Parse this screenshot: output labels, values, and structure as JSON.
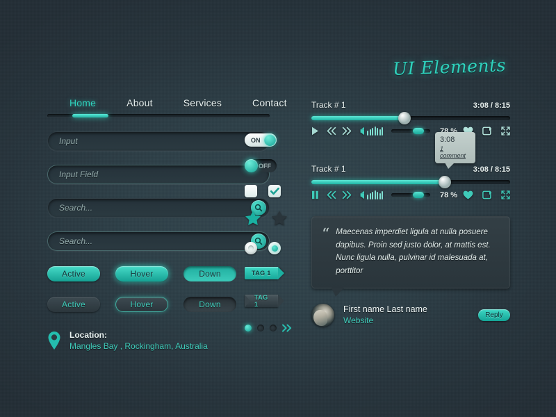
{
  "page": {
    "title": "UI Elements"
  },
  "nav": {
    "items": [
      {
        "label": "Home",
        "active": true
      },
      {
        "label": "About",
        "active": false
      },
      {
        "label": "Services",
        "active": false
      },
      {
        "label": "Contact",
        "active": false
      }
    ]
  },
  "inputs": {
    "input_placeholder": "Input",
    "input_field_placeholder": "Input Field",
    "search_placeholder_1": "Search...",
    "search_placeholder_2": "Search...",
    "search_icon": "search-icon"
  },
  "buttons": {
    "teal": [
      {
        "label": "Active",
        "state": "active"
      },
      {
        "label": "Hover",
        "state": "hover"
      },
      {
        "label": "Down",
        "state": "down"
      }
    ],
    "dark": [
      {
        "label": "Active",
        "state": "active"
      },
      {
        "label": "Hover",
        "state": "hover"
      },
      {
        "label": "Down",
        "state": "down"
      }
    ]
  },
  "location": {
    "icon": "map-pin-icon",
    "label": "Location:",
    "value": "Mangles Bay , Rockingham, Australia"
  },
  "controls": {
    "toggle_on_label": "ON",
    "toggle_off_label": "OFF",
    "checkbox_unchecked": "checkbox-empty",
    "checkbox_checked": "checkbox-checked",
    "star_filled": "star-icon",
    "star_dark": "star-icon",
    "radio_off": "radio-off",
    "radio_on": "radio-on",
    "tag_teal_label": "TAG 1",
    "tag_dark_label": "TAG 1",
    "pagination": {
      "dots": [
        "on",
        "off",
        "off"
      ],
      "next_icon": "chevron-double-right-icon"
    }
  },
  "players": [
    {
      "title": "Track # 1",
      "time": "3:08 / 8:15",
      "progress_percent": 47,
      "volume_percent": 78,
      "volume_label": "78 %",
      "play_state": "play",
      "icons": [
        "play-icon",
        "rewind-icon",
        "forward-icon",
        "speaker-icon",
        "heart-icon",
        "repeat-icon",
        "expand-icon"
      ]
    },
    {
      "title": "Track # 1",
      "time": "3:08 / 8:15",
      "progress_percent": 67,
      "volume_percent": 78,
      "volume_label": "78 %",
      "play_state": "pause",
      "icons": [
        "pause-icon",
        "rewind-icon",
        "forward-icon",
        "speaker-icon",
        "heart-icon",
        "repeat-icon",
        "expand-icon"
      ],
      "tooltip": {
        "time": "3:08",
        "comments": "1 comment"
      }
    }
  ],
  "comment": {
    "quote_mark": "“",
    "text": "Maecenas imperdiet ligula at nulla posuere dapibus. Proin sed justo dolor, at mattis est. Nunc ligula nulla, pulvinar id malesuada at, porttitor",
    "author_name": "First name Last name",
    "author_site": "Website",
    "reply_label": "Reply",
    "avatar": "avatar"
  },
  "colors": {
    "accent": "#2fd2bd",
    "accent_dark": "#16a294",
    "background": "#2e4048",
    "text": "#e7f0ef",
    "tooltip_bg": "#b9c7c4"
  }
}
